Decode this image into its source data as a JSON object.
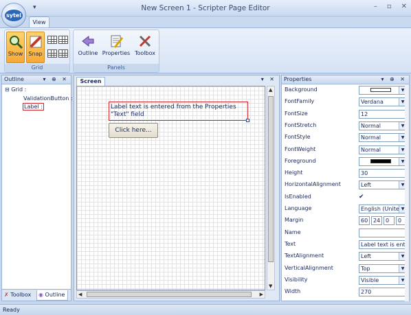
{
  "window": {
    "title": "New Screen 1 - Scripter Page Editor",
    "app_logo": "sytel",
    "qat_glyph": "▾",
    "controls": [
      "–",
      "▫",
      "✕"
    ]
  },
  "ribbon": {
    "tabs": [
      {
        "label": "View",
        "active": true
      }
    ],
    "groups": {
      "grid": {
        "label": "Grid",
        "buttons": [
          {
            "label": "Show",
            "pressed": true,
            "icon": "magnifier-icon"
          },
          {
            "label": "Snap",
            "pressed": true,
            "icon": "snap-pencil-icon"
          }
        ]
      },
      "panels": {
        "label": "Panels",
        "buttons": [
          {
            "label": "Outline",
            "icon": "outline-arrow-icon"
          },
          {
            "label": "Properties",
            "icon": "properties-icon"
          },
          {
            "label": "Toolbox",
            "icon": "toolbox-icon"
          }
        ]
      }
    }
  },
  "outline": {
    "title": "Outline",
    "ctrls": "▾ ⊕ ✕",
    "tree": {
      "root": "Grid :",
      "expander": "⊟",
      "children": [
        "ValidationButton :",
        "Label :"
      ]
    },
    "bottom_tabs": [
      {
        "label": "Toolbox",
        "active": false
      },
      {
        "label": "Outline",
        "active": true
      }
    ]
  },
  "screen": {
    "tab": "Screen",
    "ctrls": "▾ ✕",
    "label_text": "Label text is entered from the Properties \"Text\" field",
    "button_text": "Click here..."
  },
  "properties": {
    "title": "Properties",
    "ctrls": "▾ ⊕ ✕",
    "rows": [
      {
        "name": "Background",
        "type": "color",
        "color": "#ffffff"
      },
      {
        "name": "FontFamily",
        "type": "select",
        "value": "Verdana"
      },
      {
        "name": "FontSize",
        "type": "text",
        "value": "12"
      },
      {
        "name": "FontStretch",
        "type": "select",
        "value": "Normal"
      },
      {
        "name": "FontStyle",
        "type": "select",
        "value": "Normal"
      },
      {
        "name": "FontWeight",
        "type": "select",
        "value": "Normal"
      },
      {
        "name": "Foreground",
        "type": "color",
        "color": "#000000"
      },
      {
        "name": "Height",
        "type": "text",
        "value": "30"
      },
      {
        "name": "HorizontalAlignment",
        "type": "select",
        "value": "Left"
      },
      {
        "name": "IsEnabled",
        "type": "check",
        "value": "✔"
      },
      {
        "name": "Language",
        "type": "select",
        "value": "English (United States)"
      },
      {
        "name": "Margin",
        "type": "margin",
        "values": [
          "60",
          "24",
          "0",
          "0"
        ]
      },
      {
        "name": "Name",
        "type": "text",
        "value": ""
      },
      {
        "name": "Text",
        "type": "text",
        "value": "Label text is entered from the Properties \"Text\" field"
      },
      {
        "name": "TextAlignment",
        "type": "select",
        "value": "Left"
      },
      {
        "name": "VerticalAlignment",
        "type": "select",
        "value": "Top"
      },
      {
        "name": "Visibility",
        "type": "select",
        "value": "Visible"
      },
      {
        "name": "Width",
        "type": "text",
        "value": "270"
      }
    ]
  },
  "status": {
    "text": "Ready"
  }
}
